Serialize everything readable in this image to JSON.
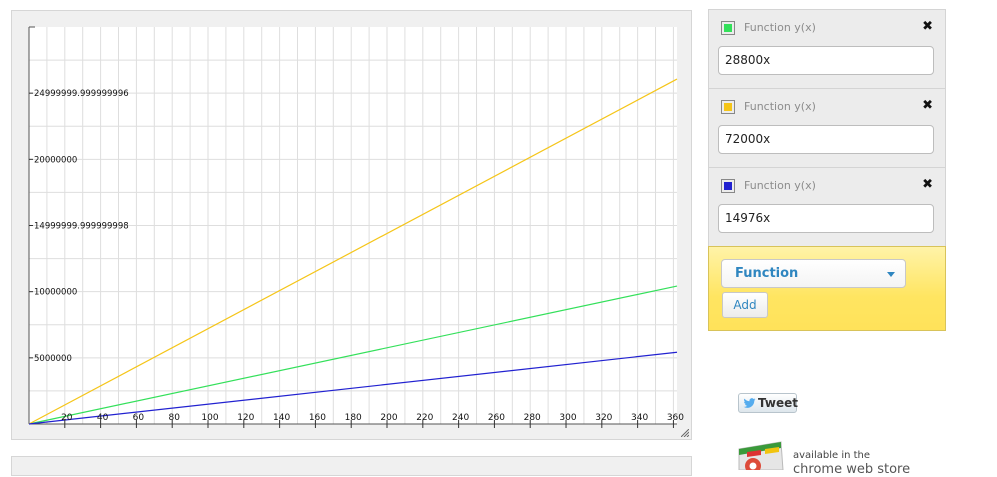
{
  "plot": {
    "y_tick_labels": [
      "5000000",
      "10000000",
      "14999999.999999998",
      "20000000",
      "24999999.999999996"
    ],
    "x_tick_labels": [
      "20",
      "40",
      "60",
      "80",
      "100",
      "120",
      "140",
      "160",
      "180",
      "200",
      "220",
      "240",
      "260",
      "280",
      "300",
      "320",
      "340",
      "360"
    ]
  },
  "chart_data": {
    "type": "line",
    "x_range": [
      0,
      362
    ],
    "y_range": [
      0,
      30000000
    ],
    "series": [
      {
        "expr": "28800x",
        "color": "#33e05a",
        "slope": 28800
      },
      {
        "expr": "72000x",
        "color": "#f5c518",
        "slope": 72000
      },
      {
        "expr": "14976x",
        "color": "#2121d0",
        "slope": 14976
      }
    ]
  },
  "functions": [
    {
      "title": "Function y(x)",
      "value": "28800x",
      "color": "#33e05a",
      "close": "✖"
    },
    {
      "title": "Function y(x)",
      "value": "72000x",
      "color": "#f5c518",
      "close": "✖"
    },
    {
      "title": "Function y(x)",
      "value": "14976x",
      "color": "#2121d0",
      "close": "✖"
    }
  ],
  "add_panel": {
    "type_selected": "Function",
    "add_label": "Add"
  },
  "tweet": {
    "label": "Tweet"
  },
  "store": {
    "small": "available in the",
    "big": "chrome web store"
  }
}
